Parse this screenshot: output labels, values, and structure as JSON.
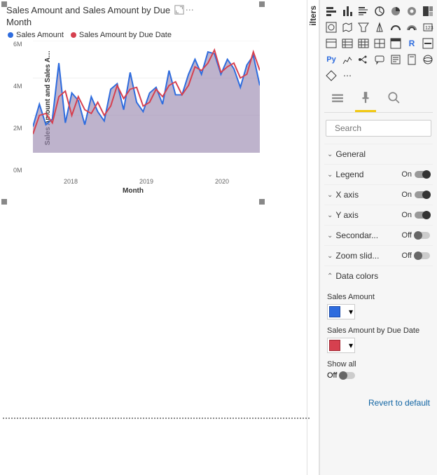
{
  "chart": {
    "title": "Sales Amount and Sales Amount by Due",
    "title_line2": "Month",
    "icons": {
      "filter": "filter-icon",
      "focus": "focus-icon",
      "more": "⋯"
    },
    "legend": [
      {
        "label": "Sales Amount",
        "color": "#2e6cde"
      },
      {
        "label": "Sales Amount by Due Date",
        "color": "#d6404f"
      }
    ],
    "y_title": "Sales Amount and Sales A…",
    "y_ticks": [
      "6M",
      "4M",
      "2M",
      "0M"
    ],
    "x_ticks": [
      "2018",
      "2019",
      "2020"
    ],
    "x_title": "Month"
  },
  "chart_data": {
    "type": "line",
    "title": "Sales Amount and Sales Amount by Due Month",
    "xlabel": "Month",
    "ylabel": "Sales Amount and Sales Amount by Due Date",
    "ylim": [
      0,
      6000000
    ],
    "categories": [
      "2017-07",
      "2017-08",
      "2017-09",
      "2017-10",
      "2017-11",
      "2017-12",
      "2018-01",
      "2018-02",
      "2018-03",
      "2018-04",
      "2018-05",
      "2018-06",
      "2018-07",
      "2018-08",
      "2018-09",
      "2018-10",
      "2018-11",
      "2018-12",
      "2019-01",
      "2019-02",
      "2019-03",
      "2019-04",
      "2019-05",
      "2019-06",
      "2019-07",
      "2019-08",
      "2019-09",
      "2019-10",
      "2019-11",
      "2019-12",
      "2020-01",
      "2020-02",
      "2020-03",
      "2020-04",
      "2020-05",
      "2020-06"
    ],
    "series": [
      {
        "name": "Sales Amount",
        "color": "#2e6cde",
        "values": [
          1400000,
          2600000,
          1500000,
          1800000,
          4800000,
          1600000,
          3200000,
          2800000,
          1500000,
          3000000,
          2200000,
          1700000,
          3400000,
          3700000,
          2300000,
          4300000,
          2700000,
          2200000,
          3200000,
          3500000,
          2600000,
          4400000,
          3100000,
          3100000,
          4200000,
          5000000,
          4200000,
          5400000,
          5300000,
          4200000,
          5000000,
          4500000,
          3500000,
          4700000,
          5200000,
          3600000
        ]
      },
      {
        "name": "Sales Amount by Due Date",
        "color": "#d6404f",
        "values": [
          1000000,
          2000000,
          2100000,
          1600000,
          3000000,
          3300000,
          2000000,
          3000000,
          2300000,
          2100000,
          2700000,
          2000000,
          2500000,
          3600000,
          2900000,
          3400000,
          3500000,
          2500000,
          2700000,
          3400000,
          3000000,
          3600000,
          3800000,
          3100000,
          3600000,
          4600000,
          4400000,
          4800000,
          5500000,
          4300000,
          4600000,
          4800000,
          4000000,
          4200000,
          5400000,
          4400000
        ]
      }
    ]
  },
  "filters_label": "ilters",
  "format_tabs": {
    "fields": "fields-tab",
    "format": "format-tab",
    "analytics": "analytics-tab"
  },
  "search": {
    "placeholder": "Search"
  },
  "sections": [
    {
      "name": "General",
      "expanded": false,
      "toggle": null
    },
    {
      "name": "Legend",
      "expanded": false,
      "toggle": "On"
    },
    {
      "name": "X axis",
      "expanded": false,
      "toggle": "On"
    },
    {
      "name": "Y axis",
      "expanded": false,
      "toggle": "On"
    },
    {
      "name": "Secondar...",
      "expanded": false,
      "toggle": "Off"
    },
    {
      "name": "Zoom slid...",
      "expanded": false,
      "toggle": "Off"
    },
    {
      "name": "Data colors",
      "expanded": true,
      "toggle": null
    }
  ],
  "data_colors": {
    "fields": [
      {
        "label": "Sales Amount",
        "color": "#2e6cde"
      },
      {
        "label": "Sales Amount by Due Date",
        "color": "#d6404f"
      }
    ],
    "show_all_label": "Show all",
    "show_all_state": "Off"
  },
  "revert_label": "Revert to default"
}
